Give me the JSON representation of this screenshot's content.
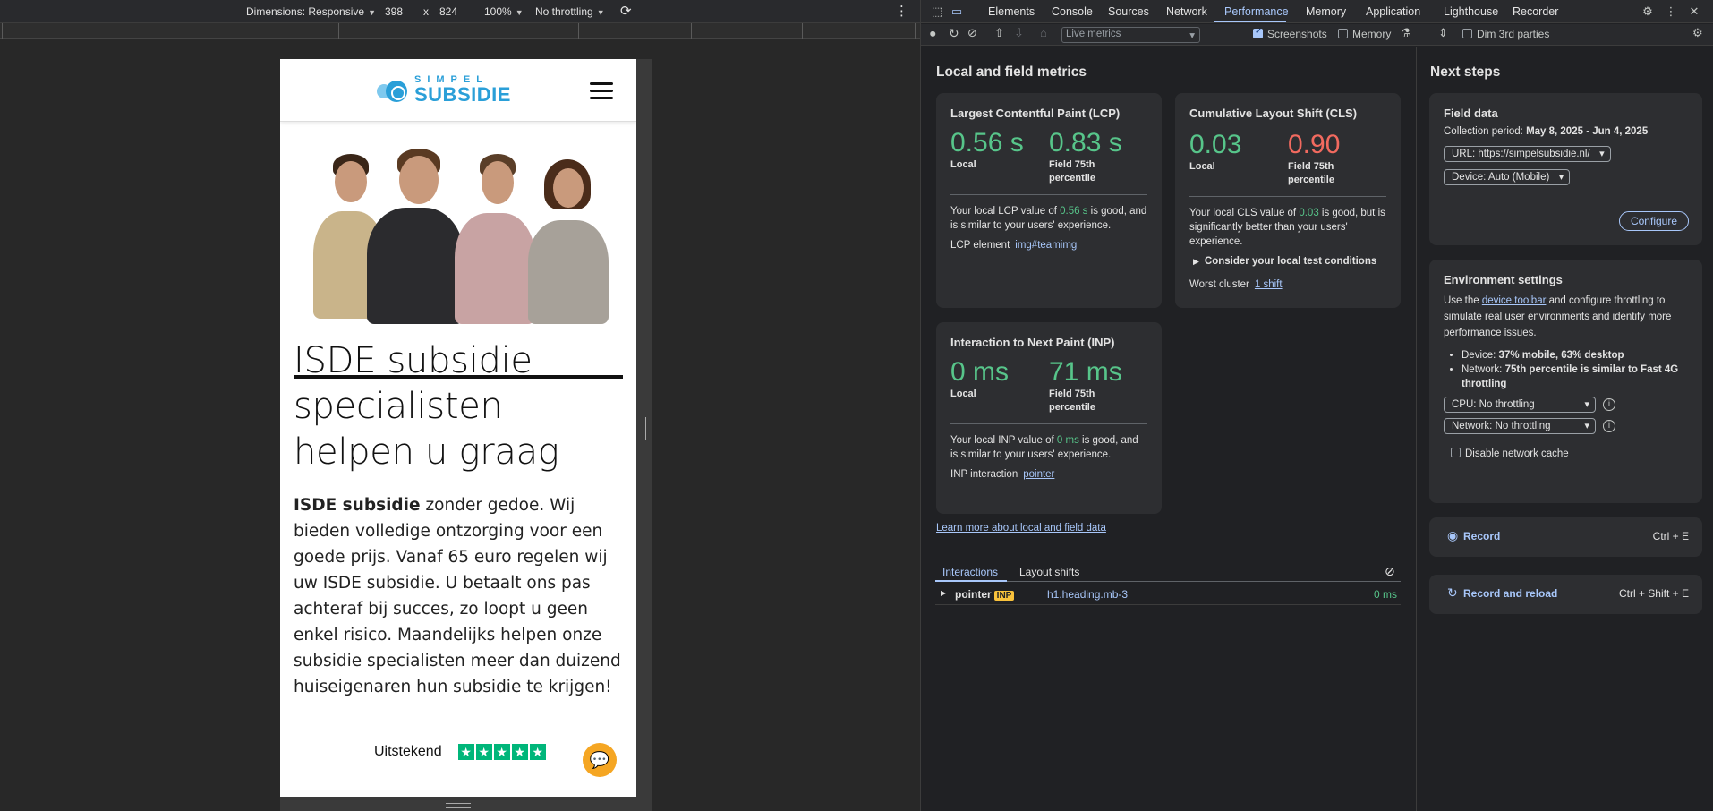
{
  "emulation": {
    "dimensions_label": "Dimensions: Responsive",
    "width": "398",
    "times": "x",
    "height": "824",
    "zoom": "100%",
    "throttling": "No throttling"
  },
  "site": {
    "logo_top": "SIMPEL",
    "logo_bottom": "SUBSIDIE",
    "hero_title": "ISDE subsidie specialisten helpen u graag",
    "hero_body_bold": "ISDE subsidie",
    "hero_body_rest": " zonder gedoe. Wij bieden volledige ontzorging voor een goede prijs. Vanaf 65 euro regelen wij uw ISDE subsidie. U betaalt ons pas achteraf bij succes, zo loopt u geen enkel risico. Maandelijks helpen onze subsidie specialisten meer dan duizend huiseigenaren hun subsidie te krijgen!",
    "trust_label": "Uitstekend",
    "stars": 5
  },
  "devtools": {
    "tabs": [
      "Elements",
      "Console",
      "Sources",
      "Network",
      "Performance",
      "Memory",
      "Application",
      "Lighthouse",
      "Recorder"
    ],
    "active_tab": "Performance",
    "toolbar": {
      "live_metrics": "Live metrics",
      "screenshots": "Screenshots",
      "memory": "Memory",
      "dim_3rd": "Dim 3rd parties"
    },
    "metrics_title": "Local and field metrics",
    "lcp": {
      "title": "Largest Contentful Paint (LCP)",
      "local": "0.56 s",
      "local_label": "Local",
      "field": "0.83 s",
      "field_label": "Field 75th percentile",
      "desc_pre": "Your local LCP value of ",
      "desc_val": "0.56 s",
      "desc_post": " is good, and is similar to your users' experience.",
      "element_label": "LCP element",
      "element_value": "img#teamimg"
    },
    "cls": {
      "title": "Cumulative Layout Shift (CLS)",
      "local": "0.03",
      "local_label": "Local",
      "field": "0.90",
      "field_label": "Field 75th percentile",
      "desc_pre": "Your local CLS value of ",
      "desc_val": "0.03",
      "desc_post": " is good, but is significantly better than your users' experience.",
      "consider": "Consider your local test conditions",
      "worst_label": "Worst cluster",
      "worst_value": "1 shift"
    },
    "inp": {
      "title": "Interaction to Next Paint (INP)",
      "local": "0 ms",
      "local_label": "Local",
      "field": "71 ms",
      "field_label": "Field 75th percentile",
      "desc_pre": "Your local INP value of ",
      "desc_val": "0 ms",
      "desc_post": " is good, and is similar to your users' experience.",
      "interaction_label": "INP interaction",
      "interaction_value": "pointer"
    },
    "learn_more": "Learn more about local and field data",
    "interaction_tabs": [
      "Interactions",
      "Layout shifts"
    ],
    "interaction_row": {
      "type": "pointer",
      "badge": "INP",
      "target": "h1.heading.mb-3",
      "time": "0 ms"
    },
    "next_steps": {
      "title": "Next steps",
      "field_data_title": "Field data",
      "collection_label": "Collection period: ",
      "collection_value": "May 8, 2025 - Jun 4, 2025",
      "url_select": "URL: https://simpelsubsidie.nl/",
      "device_select": "Device: Auto (Mobile)",
      "configure": "Configure",
      "env_title": "Environment settings",
      "env_pre": "Use the ",
      "env_link": "device toolbar",
      "env_post": " and configure throttling to simulate real user environments and identify more performance issues.",
      "bullet1_label": "Device: ",
      "bullet1_value": "37% mobile, 63% desktop",
      "bullet2_label": "Network: ",
      "bullet2_value": "75th percentile is similar to Fast 4G throttling",
      "cpu_select": "CPU: No throttling",
      "network_select": "Network: No throttling",
      "disable_cache": "Disable network cache",
      "record": "Record",
      "record_key": "Ctrl + E",
      "record_reload": "Record and reload",
      "record_reload_key": "Ctrl + Shift + E"
    }
  },
  "colors": {
    "good": "#57c58a",
    "bad": "#f26a5f",
    "accent": "#a8c7fa",
    "brand": "#2a9fd8",
    "trustpilot": "#00b67a",
    "chat": "#f5a623"
  }
}
